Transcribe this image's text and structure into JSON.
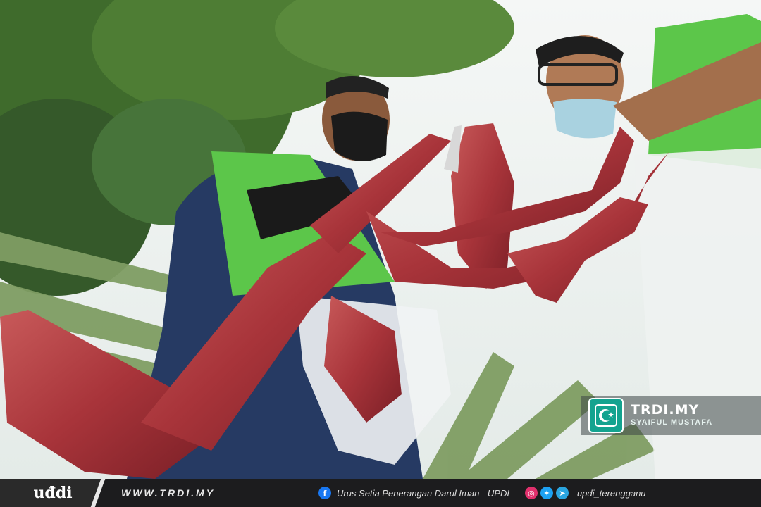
{
  "credit": {
    "site": "TRDI.MY",
    "author": "SYAIFUL MUSTAFA",
    "logo_icon": "crescent-star-icon"
  },
  "footer": {
    "brand": "uđdi",
    "website": "WWW.TRDI.MY",
    "facebook_label": "Urus Setia Penerangan Darul Iman - UPDI",
    "social_handle": "updi_terengganu",
    "icons": [
      "facebook-icon",
      "instagram-icon",
      "twitter-icon",
      "telegram-icon"
    ]
  },
  "colors": {
    "accent": "#13a38f",
    "footer_bg": "#1c1c1e",
    "shirt_green": "#5cc64a",
    "meat_red": "#a8343a"
  }
}
